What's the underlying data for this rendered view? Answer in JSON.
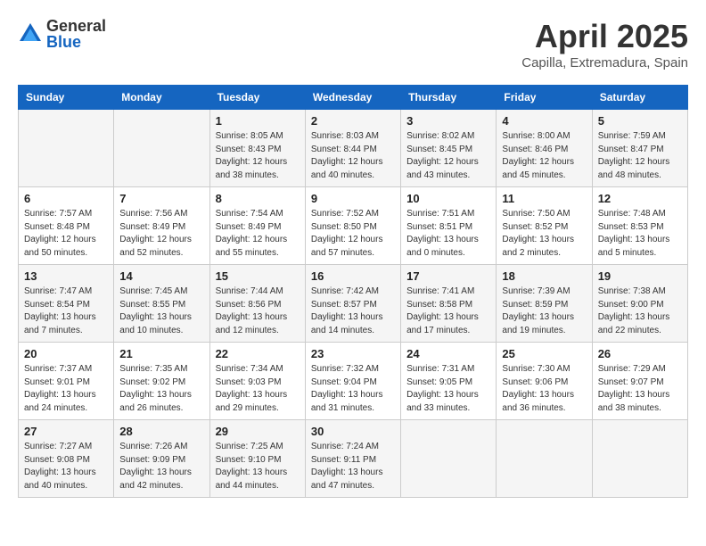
{
  "header": {
    "logo_general": "General",
    "logo_blue": "Blue",
    "month_title": "April 2025",
    "subtitle": "Capilla, Extremadura, Spain"
  },
  "weekdays": [
    "Sunday",
    "Monday",
    "Tuesday",
    "Wednesday",
    "Thursday",
    "Friday",
    "Saturday"
  ],
  "weeks": [
    [
      {
        "day": "",
        "info": ""
      },
      {
        "day": "",
        "info": ""
      },
      {
        "day": "1",
        "info": "Sunrise: 8:05 AM\nSunset: 8:43 PM\nDaylight: 12 hours and 38 minutes."
      },
      {
        "day": "2",
        "info": "Sunrise: 8:03 AM\nSunset: 8:44 PM\nDaylight: 12 hours and 40 minutes."
      },
      {
        "day": "3",
        "info": "Sunrise: 8:02 AM\nSunset: 8:45 PM\nDaylight: 12 hours and 43 minutes."
      },
      {
        "day": "4",
        "info": "Sunrise: 8:00 AM\nSunset: 8:46 PM\nDaylight: 12 hours and 45 minutes."
      },
      {
        "day": "5",
        "info": "Sunrise: 7:59 AM\nSunset: 8:47 PM\nDaylight: 12 hours and 48 minutes."
      }
    ],
    [
      {
        "day": "6",
        "info": "Sunrise: 7:57 AM\nSunset: 8:48 PM\nDaylight: 12 hours and 50 minutes."
      },
      {
        "day": "7",
        "info": "Sunrise: 7:56 AM\nSunset: 8:49 PM\nDaylight: 12 hours and 52 minutes."
      },
      {
        "day": "8",
        "info": "Sunrise: 7:54 AM\nSunset: 8:49 PM\nDaylight: 12 hours and 55 minutes."
      },
      {
        "day": "9",
        "info": "Sunrise: 7:52 AM\nSunset: 8:50 PM\nDaylight: 12 hours and 57 minutes."
      },
      {
        "day": "10",
        "info": "Sunrise: 7:51 AM\nSunset: 8:51 PM\nDaylight: 13 hours and 0 minutes."
      },
      {
        "day": "11",
        "info": "Sunrise: 7:50 AM\nSunset: 8:52 PM\nDaylight: 13 hours and 2 minutes."
      },
      {
        "day": "12",
        "info": "Sunrise: 7:48 AM\nSunset: 8:53 PM\nDaylight: 13 hours and 5 minutes."
      }
    ],
    [
      {
        "day": "13",
        "info": "Sunrise: 7:47 AM\nSunset: 8:54 PM\nDaylight: 13 hours and 7 minutes."
      },
      {
        "day": "14",
        "info": "Sunrise: 7:45 AM\nSunset: 8:55 PM\nDaylight: 13 hours and 10 minutes."
      },
      {
        "day": "15",
        "info": "Sunrise: 7:44 AM\nSunset: 8:56 PM\nDaylight: 13 hours and 12 minutes."
      },
      {
        "day": "16",
        "info": "Sunrise: 7:42 AM\nSunset: 8:57 PM\nDaylight: 13 hours and 14 minutes."
      },
      {
        "day": "17",
        "info": "Sunrise: 7:41 AM\nSunset: 8:58 PM\nDaylight: 13 hours and 17 minutes."
      },
      {
        "day": "18",
        "info": "Sunrise: 7:39 AM\nSunset: 8:59 PM\nDaylight: 13 hours and 19 minutes."
      },
      {
        "day": "19",
        "info": "Sunrise: 7:38 AM\nSunset: 9:00 PM\nDaylight: 13 hours and 22 minutes."
      }
    ],
    [
      {
        "day": "20",
        "info": "Sunrise: 7:37 AM\nSunset: 9:01 PM\nDaylight: 13 hours and 24 minutes."
      },
      {
        "day": "21",
        "info": "Sunrise: 7:35 AM\nSunset: 9:02 PM\nDaylight: 13 hours and 26 minutes."
      },
      {
        "day": "22",
        "info": "Sunrise: 7:34 AM\nSunset: 9:03 PM\nDaylight: 13 hours and 29 minutes."
      },
      {
        "day": "23",
        "info": "Sunrise: 7:32 AM\nSunset: 9:04 PM\nDaylight: 13 hours and 31 minutes."
      },
      {
        "day": "24",
        "info": "Sunrise: 7:31 AM\nSunset: 9:05 PM\nDaylight: 13 hours and 33 minutes."
      },
      {
        "day": "25",
        "info": "Sunrise: 7:30 AM\nSunset: 9:06 PM\nDaylight: 13 hours and 36 minutes."
      },
      {
        "day": "26",
        "info": "Sunrise: 7:29 AM\nSunset: 9:07 PM\nDaylight: 13 hours and 38 minutes."
      }
    ],
    [
      {
        "day": "27",
        "info": "Sunrise: 7:27 AM\nSunset: 9:08 PM\nDaylight: 13 hours and 40 minutes."
      },
      {
        "day": "28",
        "info": "Sunrise: 7:26 AM\nSunset: 9:09 PM\nDaylight: 13 hours and 42 minutes."
      },
      {
        "day": "29",
        "info": "Sunrise: 7:25 AM\nSunset: 9:10 PM\nDaylight: 13 hours and 44 minutes."
      },
      {
        "day": "30",
        "info": "Sunrise: 7:24 AM\nSunset: 9:11 PM\nDaylight: 13 hours and 47 minutes."
      },
      {
        "day": "",
        "info": ""
      },
      {
        "day": "",
        "info": ""
      },
      {
        "day": "",
        "info": ""
      }
    ]
  ]
}
